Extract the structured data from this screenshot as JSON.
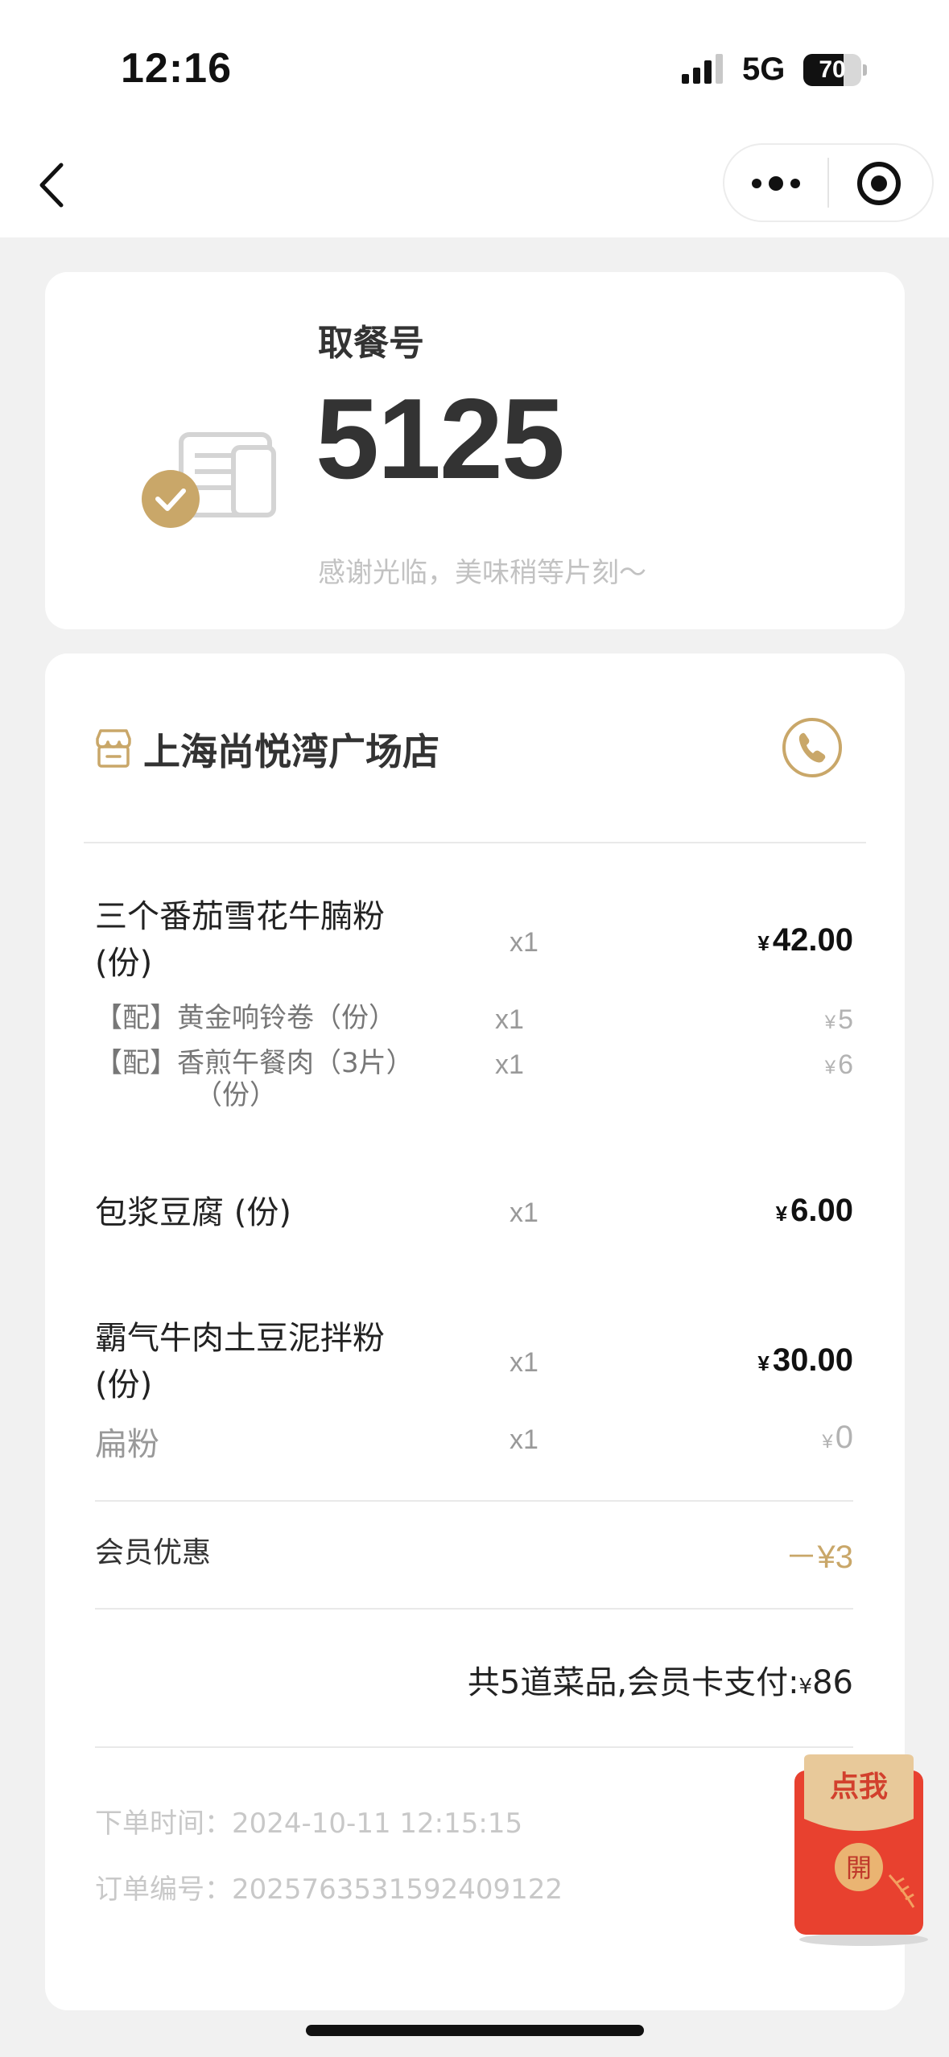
{
  "status_bar": {
    "time": "12:16",
    "network": "5G",
    "battery": "70",
    "battery_level": 0.7
  },
  "nav": {
    "back_icon": "chevron-left-icon",
    "more_icon": "more-dots-icon",
    "close_icon": "target-circle-icon"
  },
  "pickup": {
    "label": "取餐号",
    "number": "5125",
    "message": "感谢光临，美味稍等片刻～"
  },
  "store": {
    "name": "上海尚悦湾广场店",
    "icon": "store-icon",
    "phone_icon": "phone-icon"
  },
  "currency": "¥",
  "items": [
    {
      "name_line1": "三个番茄雪花牛腩粉",
      "name_line2": "(份)",
      "qty": "x1",
      "price": "42.00"
    },
    {
      "name": "包浆豆腐 (份)",
      "qty": "x1",
      "price": "6.00"
    },
    {
      "name_line1": "霸气牛肉土豆泥拌粉",
      "name_line2": "(份)",
      "qty": "x1",
      "price": "30.00"
    }
  ],
  "sub_items": [
    {
      "name": "【配】黄金响铃卷（份）",
      "qty": "x1",
      "price": "5"
    },
    {
      "name_line1": "【配】香煎午餐肉（3片）",
      "name_line2": "（份）",
      "qty": "x1",
      "price": "6"
    },
    {
      "name": "扁粉",
      "qty": "x1",
      "price": "0"
    }
  ],
  "discount": {
    "label": "会员优惠",
    "value": "－¥3"
  },
  "total": {
    "text": "共5道菜品,会员卡支付:",
    "amount": "86"
  },
  "order": {
    "time": "下单时间：2024-10-11 12:15:15",
    "number": "订单编号：2025763531592409122"
  },
  "envelope": {
    "top_text": "点我",
    "seal_text": "開",
    "top_color": "#e8c99a",
    "body_color": "#e8412f"
  },
  "colors": {
    "accent_gold": "#c9a769",
    "card_bg": "#ffffff",
    "page_bg": "#f1f1f1"
  }
}
